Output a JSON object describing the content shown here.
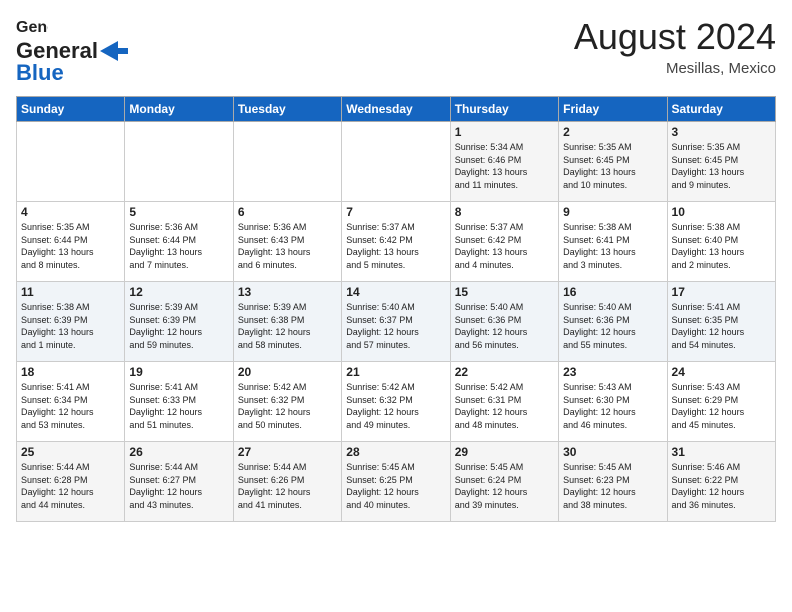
{
  "header": {
    "logo_line1": "General",
    "logo_line2": "Blue",
    "month": "August 2024",
    "location": "Mesillas, Mexico"
  },
  "weekdays": [
    "Sunday",
    "Monday",
    "Tuesday",
    "Wednesday",
    "Thursday",
    "Friday",
    "Saturday"
  ],
  "rows": [
    [
      {
        "day": "",
        "info": ""
      },
      {
        "day": "",
        "info": ""
      },
      {
        "day": "",
        "info": ""
      },
      {
        "day": "",
        "info": ""
      },
      {
        "day": "1",
        "info": "Sunrise: 5:34 AM\nSunset: 6:46 PM\nDaylight: 13 hours\nand 11 minutes."
      },
      {
        "day": "2",
        "info": "Sunrise: 5:35 AM\nSunset: 6:45 PM\nDaylight: 13 hours\nand 10 minutes."
      },
      {
        "day": "3",
        "info": "Sunrise: 5:35 AM\nSunset: 6:45 PM\nDaylight: 13 hours\nand 9 minutes."
      }
    ],
    [
      {
        "day": "4",
        "info": "Sunrise: 5:35 AM\nSunset: 6:44 PM\nDaylight: 13 hours\nand 8 minutes."
      },
      {
        "day": "5",
        "info": "Sunrise: 5:36 AM\nSunset: 6:44 PM\nDaylight: 13 hours\nand 7 minutes."
      },
      {
        "day": "6",
        "info": "Sunrise: 5:36 AM\nSunset: 6:43 PM\nDaylight: 13 hours\nand 6 minutes."
      },
      {
        "day": "7",
        "info": "Sunrise: 5:37 AM\nSunset: 6:42 PM\nDaylight: 13 hours\nand 5 minutes."
      },
      {
        "day": "8",
        "info": "Sunrise: 5:37 AM\nSunset: 6:42 PM\nDaylight: 13 hours\nand 4 minutes."
      },
      {
        "day": "9",
        "info": "Sunrise: 5:38 AM\nSunset: 6:41 PM\nDaylight: 13 hours\nand 3 minutes."
      },
      {
        "day": "10",
        "info": "Sunrise: 5:38 AM\nSunset: 6:40 PM\nDaylight: 13 hours\nand 2 minutes."
      }
    ],
    [
      {
        "day": "11",
        "info": "Sunrise: 5:38 AM\nSunset: 6:39 PM\nDaylight: 13 hours\nand 1 minute."
      },
      {
        "day": "12",
        "info": "Sunrise: 5:39 AM\nSunset: 6:39 PM\nDaylight: 12 hours\nand 59 minutes."
      },
      {
        "day": "13",
        "info": "Sunrise: 5:39 AM\nSunset: 6:38 PM\nDaylight: 12 hours\nand 58 minutes."
      },
      {
        "day": "14",
        "info": "Sunrise: 5:40 AM\nSunset: 6:37 PM\nDaylight: 12 hours\nand 57 minutes."
      },
      {
        "day": "15",
        "info": "Sunrise: 5:40 AM\nSunset: 6:36 PM\nDaylight: 12 hours\nand 56 minutes."
      },
      {
        "day": "16",
        "info": "Sunrise: 5:40 AM\nSunset: 6:36 PM\nDaylight: 12 hours\nand 55 minutes."
      },
      {
        "day": "17",
        "info": "Sunrise: 5:41 AM\nSunset: 6:35 PM\nDaylight: 12 hours\nand 54 minutes."
      }
    ],
    [
      {
        "day": "18",
        "info": "Sunrise: 5:41 AM\nSunset: 6:34 PM\nDaylight: 12 hours\nand 53 minutes."
      },
      {
        "day": "19",
        "info": "Sunrise: 5:41 AM\nSunset: 6:33 PM\nDaylight: 12 hours\nand 51 minutes."
      },
      {
        "day": "20",
        "info": "Sunrise: 5:42 AM\nSunset: 6:32 PM\nDaylight: 12 hours\nand 50 minutes."
      },
      {
        "day": "21",
        "info": "Sunrise: 5:42 AM\nSunset: 6:32 PM\nDaylight: 12 hours\nand 49 minutes."
      },
      {
        "day": "22",
        "info": "Sunrise: 5:42 AM\nSunset: 6:31 PM\nDaylight: 12 hours\nand 48 minutes."
      },
      {
        "day": "23",
        "info": "Sunrise: 5:43 AM\nSunset: 6:30 PM\nDaylight: 12 hours\nand 46 minutes."
      },
      {
        "day": "24",
        "info": "Sunrise: 5:43 AM\nSunset: 6:29 PM\nDaylight: 12 hours\nand 45 minutes."
      }
    ],
    [
      {
        "day": "25",
        "info": "Sunrise: 5:44 AM\nSunset: 6:28 PM\nDaylight: 12 hours\nand 44 minutes."
      },
      {
        "day": "26",
        "info": "Sunrise: 5:44 AM\nSunset: 6:27 PM\nDaylight: 12 hours\nand 43 minutes."
      },
      {
        "day": "27",
        "info": "Sunrise: 5:44 AM\nSunset: 6:26 PM\nDaylight: 12 hours\nand 41 minutes."
      },
      {
        "day": "28",
        "info": "Sunrise: 5:45 AM\nSunset: 6:25 PM\nDaylight: 12 hours\nand 40 minutes."
      },
      {
        "day": "29",
        "info": "Sunrise: 5:45 AM\nSunset: 6:24 PM\nDaylight: 12 hours\nand 39 minutes."
      },
      {
        "day": "30",
        "info": "Sunrise: 5:45 AM\nSunset: 6:23 PM\nDaylight: 12 hours\nand 38 minutes."
      },
      {
        "day": "31",
        "info": "Sunrise: 5:46 AM\nSunset: 6:22 PM\nDaylight: 12 hours\nand 36 minutes."
      }
    ]
  ]
}
